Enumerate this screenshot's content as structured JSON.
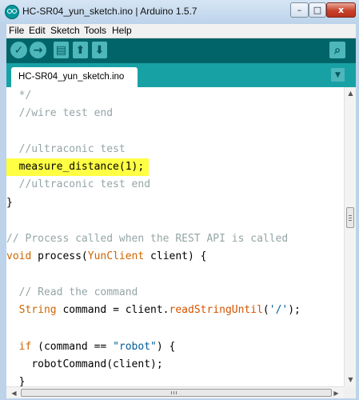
{
  "window": {
    "title": "HC-SR04_yun_sketch.ino | Arduino 1.5.7",
    "minimize_glyph": "–",
    "maximize_glyph": "□",
    "close_glyph": "x"
  },
  "menu": {
    "items": [
      "File",
      "Edit",
      "Sketch",
      "Tools",
      "Help"
    ]
  },
  "toolbar": {
    "verify_icon": "✓",
    "upload_icon": "→",
    "new_icon": "▤",
    "open_icon": "⬆",
    "save_icon": "⬇",
    "serial_monitor_icon": "⌕"
  },
  "tabs": [
    {
      "label": "HC-SR04_yun_sketch.ino"
    }
  ],
  "tab_menu_icon": "▼",
  "code": {
    "l1": "*/",
    "l2": "//wire test end",
    "l4": "//ultraconic test",
    "l5": "measure_distance(1);",
    "l6": "//ultraconic test end",
    "l7": "}",
    "l9": "// Process called when the REST API is called",
    "l10_kw": "void",
    "l10_a": " process(",
    "l10_type": "YunClient",
    "l10_b": " client) {",
    "l12": "// Read the command",
    "l13_type": "String",
    "l13_a": " command = client.",
    "l13_func": "readStringUntil",
    "l13_b": "(",
    "l13_str": "'/'",
    "l13_c": ");",
    "l15_kw": "if",
    "l15_a": " (command == ",
    "l15_str": "\"robot\"",
    "l15_b": ") {",
    "l16": "robotCommand(client);",
    "l17": "}"
  },
  "colors": {
    "toolbar": "#006468",
    "tabbar": "#17a1a5",
    "highlight": "#ffff44",
    "comment": "#95a5a6",
    "keyword": "#cc6600"
  }
}
